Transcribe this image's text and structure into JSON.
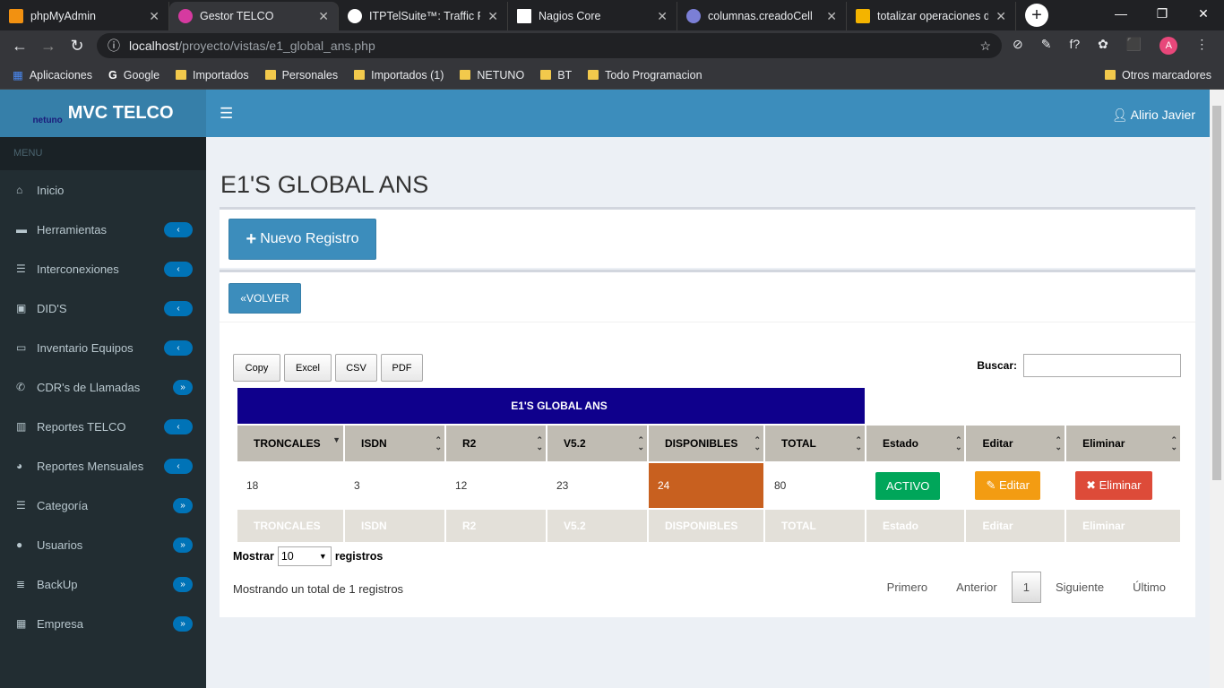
{
  "browser": {
    "tabs": [
      {
        "title": "phpMyAdmin",
        "color": "#f29111",
        "active": false
      },
      {
        "title": "Gestor TELCO",
        "color": "#d63aa0",
        "active": true
      },
      {
        "title": "ITPTelSuite™: Traffic Rep",
        "color": "#ffffff",
        "active": false
      },
      {
        "title": "Nagios Core",
        "color": "#ffffff",
        "active": false
      },
      {
        "title": "columnas.creadoCell",
        "color": "#7b7fd6",
        "active": false
      },
      {
        "title": "totalizar operaciones de",
        "color": "#f4b400",
        "active": false
      }
    ],
    "url_host": "localhost",
    "url_path": "/proyecto/vistas/e1_global_ans.php",
    "bookmarks": [
      "Aplicaciones",
      "Google",
      "Importados",
      "Personales",
      "Importados (1)",
      "NETUNO",
      "BT",
      "Todo Programacion"
    ],
    "other_bookmarks": "Otros marcadores",
    "profile_initial": "A"
  },
  "app": {
    "brand": "MVC TELCO",
    "logo_text": "netuno",
    "user": "Alirio Javier"
  },
  "sidebar": {
    "header": "MENU",
    "items": [
      {
        "label": "Inicio",
        "icon": "home-icon"
      },
      {
        "label": "Herramientas",
        "icon": "briefcase-icon",
        "badge": "‹"
      },
      {
        "label": "Interconexiones",
        "icon": "list-icon",
        "badge": "‹"
      },
      {
        "label": "DID'S",
        "icon": "contact-icon",
        "badge": "‹"
      },
      {
        "label": "Inventario Equipos",
        "icon": "laptop-icon",
        "badge": "‹"
      },
      {
        "label": "CDR's de Llamadas",
        "icon": "phone-icon",
        "badge": "»"
      },
      {
        "label": "Reportes TELCO",
        "icon": "bar-chart-icon",
        "badge": "‹"
      },
      {
        "label": "Reportes Mensuales",
        "icon": "pie-chart-icon",
        "badge": "‹"
      },
      {
        "label": "Categoría",
        "icon": "list-icon",
        "badge": "»"
      },
      {
        "label": "Usuarios",
        "icon": "user-icon",
        "badge": "»"
      },
      {
        "label": "BackUp",
        "icon": "database-icon",
        "badge": "»"
      },
      {
        "label": "Empresa",
        "icon": "building-icon",
        "badge": "»"
      }
    ]
  },
  "page": {
    "title": "E1'S GLOBAL ANS",
    "new_button": "Nuevo Registro",
    "back_button": "VOLVER",
    "export": [
      "Copy",
      "Excel",
      "CSV",
      "PDF"
    ],
    "search_label": "Buscar:",
    "search_value": "",
    "table": {
      "caption": "E1'S GLOBAL ANS",
      "columns": [
        "TRONCALES",
        "ISDN",
        "R2",
        "V5.2",
        "DISPONIBLES",
        "TOTAL",
        "Estado",
        "Editar",
        "Eliminar"
      ],
      "rows": [
        {
          "troncales": "18",
          "isdn": "3",
          "r2": "12",
          "v52": "23",
          "disponibles": "24",
          "total": "80",
          "estado": "ACTIVO",
          "editar": "Editar",
          "eliminar": "Eliminar"
        }
      ]
    },
    "length_prefix": "Mostrar",
    "length_value": "10",
    "length_suffix": "registros",
    "info": "Mostrando un total de 1 registros",
    "pagination": {
      "first": "Primero",
      "prev": "Anterior",
      "current": "1",
      "next": "Siguiente",
      "last": "Último"
    }
  },
  "colors": {
    "header": "#3c8dbc",
    "sidebar": "#222d32",
    "caption": "#0f008c",
    "disponibles": "#c8601f",
    "activo": "#00a65a",
    "editar": "#f39c12",
    "eliminar": "#dd4b39"
  }
}
